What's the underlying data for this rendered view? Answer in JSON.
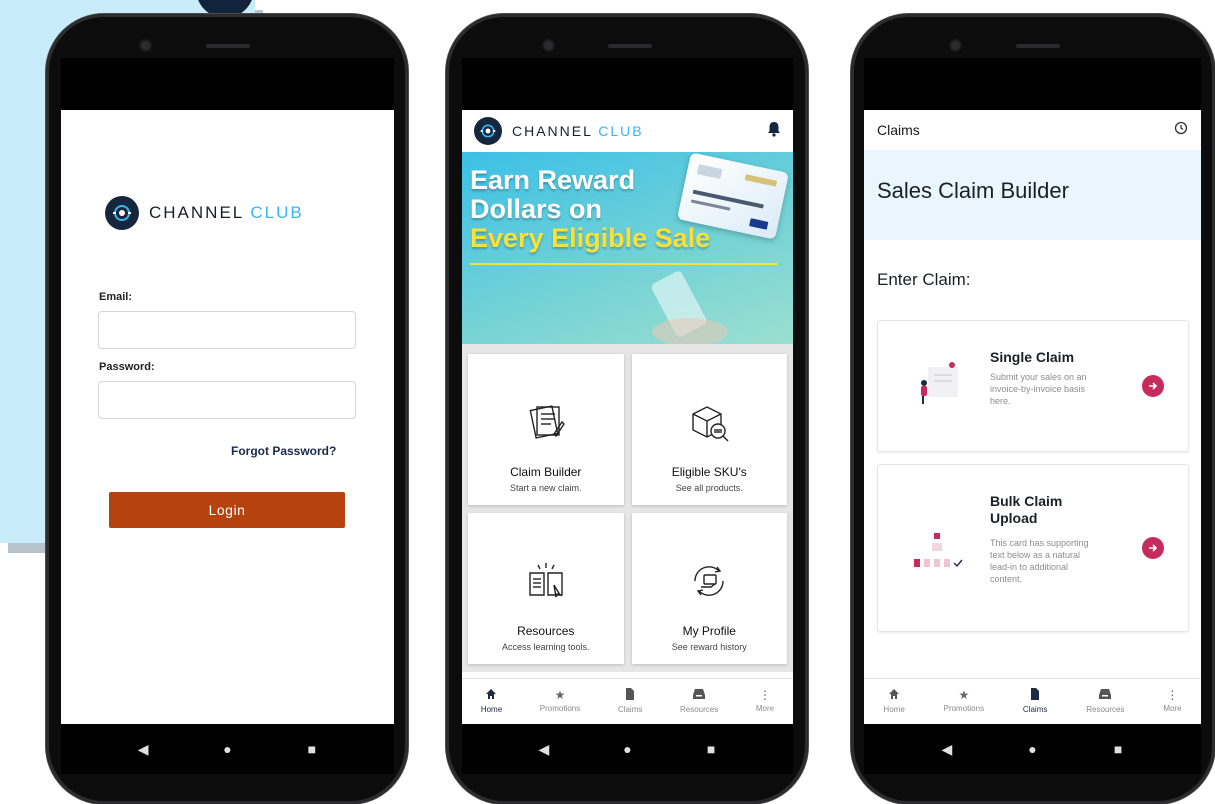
{
  "brand": {
    "name_primary": "CHANNEL",
    "name_secondary": "CLUB"
  },
  "login": {
    "email_label": "Email:",
    "email_value": "",
    "password_label": "Password:",
    "password_value": "",
    "forgot_password": "Forgot Password?",
    "login_button": "Login"
  },
  "home": {
    "banner": {
      "line1": "Earn Reward",
      "line2": "Dollars on",
      "line3": "Every Eligible Sale"
    },
    "tiles": [
      {
        "title": "Claim Builder",
        "subtitle": "Start a new claim."
      },
      {
        "title": "Eligible SKU's",
        "subtitle": "See all products."
      },
      {
        "title": "Resources",
        "subtitle": "Access learning tools."
      },
      {
        "title": "My Profile",
        "subtitle": "See reward history"
      }
    ]
  },
  "bottom_nav": [
    "Home",
    "Promotions",
    "Claims",
    "Resources",
    "More"
  ],
  "claims": {
    "header_title": "Claims",
    "page_title": "Sales Claim Builder",
    "section_title": "Enter Claim:",
    "cards": [
      {
        "title": "Single Claim",
        "description": "Submit your sales on an invoice-by-invoice basis here."
      },
      {
        "title": "Bulk Claim Upload",
        "description": "This card has supporting text below as a natural lead-in to additional content."
      }
    ]
  },
  "colors": {
    "brand_navy": "#16263f",
    "brand_cyan": "#38b7ea",
    "login_button": "#b6420d",
    "claim_accent": "#c72a5c",
    "banner_yellow": "#f7e23b"
  }
}
